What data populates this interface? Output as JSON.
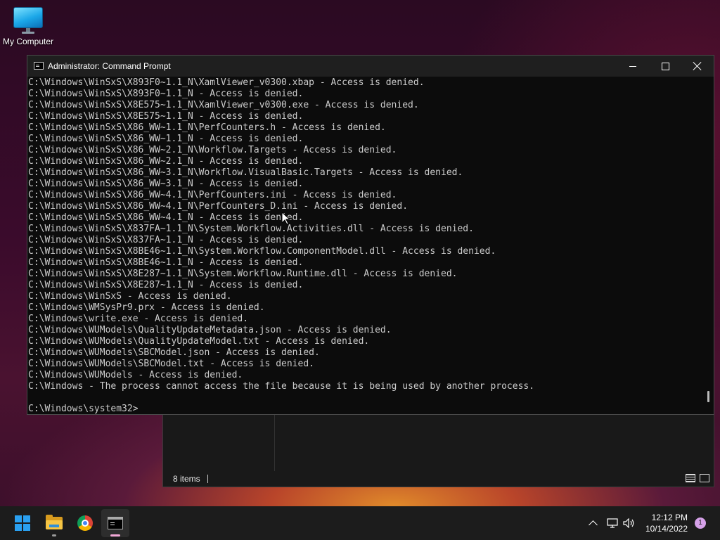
{
  "desktop": {
    "icons": [
      {
        "label": "My Computer",
        "icon": "monitor-icon"
      }
    ]
  },
  "explorer": {
    "status_text": "8 items"
  },
  "cmd": {
    "title": "Administrator: Command Prompt",
    "lines": [
      "C:\\Windows\\WinSxS\\X893F0~1.1_N\\XamlViewer_v0300.xbap - Access is denied.",
      "C:\\Windows\\WinSxS\\X893F0~1.1_N - Access is denied.",
      "C:\\Windows\\WinSxS\\X8E575~1.1_N\\XamlViewer_v0300.exe - Access is denied.",
      "C:\\Windows\\WinSxS\\X8E575~1.1_N - Access is denied.",
      "C:\\Windows\\WinSxS\\X86_WW~1.1_N\\PerfCounters.h - Access is denied.",
      "C:\\Windows\\WinSxS\\X86_WW~1.1_N - Access is denied.",
      "C:\\Windows\\WinSxS\\X86_WW~2.1_N\\Workflow.Targets - Access is denied.",
      "C:\\Windows\\WinSxS\\X86_WW~2.1_N - Access is denied.",
      "C:\\Windows\\WinSxS\\X86_WW~3.1_N\\Workflow.VisualBasic.Targets - Access is denied.",
      "C:\\Windows\\WinSxS\\X86_WW~3.1_N - Access is denied.",
      "C:\\Windows\\WinSxS\\X86_WW~4.1_N\\PerfCounters.ini - Access is denied.",
      "C:\\Windows\\WinSxS\\X86_WW~4.1_N\\PerfCounters_D.ini - Access is denied.",
      "C:\\Windows\\WinSxS\\X86_WW~4.1_N - Access is denied.",
      "C:\\Windows\\WinSxS\\X837FA~1.1_N\\System.Workflow.Activities.dll - Access is denied.",
      "C:\\Windows\\WinSxS\\X837FA~1.1_N - Access is denied.",
      "C:\\Windows\\WinSxS\\X8BE46~1.1_N\\System.Workflow.ComponentModel.dll - Access is denied.",
      "C:\\Windows\\WinSxS\\X8BE46~1.1_N - Access is denied.",
      "C:\\Windows\\WinSxS\\X8E287~1.1_N\\System.Workflow.Runtime.dll - Access is denied.",
      "C:\\Windows\\WinSxS\\X8E287~1.1_N - Access is denied.",
      "C:\\Windows\\WinSxS - Access is denied.",
      "C:\\Windows\\WMSysPr9.prx - Access is denied.",
      "C:\\Windows\\write.exe - Access is denied.",
      "C:\\Windows\\WUModels\\QualityUpdateMetadata.json - Access is denied.",
      "C:\\Windows\\WUModels\\QualityUpdateModel.txt - Access is denied.",
      "C:\\Windows\\WUModels\\SBCModel.json - Access is denied.",
      "C:\\Windows\\WUModels\\SBCModel.txt - Access is denied.",
      "C:\\Windows\\WUModels - Access is denied.",
      "C:\\Windows - The process cannot access the file because it is being used by another process.",
      "",
      "C:\\Windows\\system32>"
    ]
  },
  "taskbar": {
    "apps": [
      {
        "name": "start",
        "icon": "windows-logo-icon"
      },
      {
        "name": "file-explorer",
        "icon": "folder-icon"
      },
      {
        "name": "chrome",
        "icon": "chrome-icon"
      },
      {
        "name": "command-prompt",
        "icon": "terminal-icon",
        "active": true
      }
    ],
    "time": "12:12 PM",
    "date": "10/14/2022",
    "notification_count": "1"
  }
}
